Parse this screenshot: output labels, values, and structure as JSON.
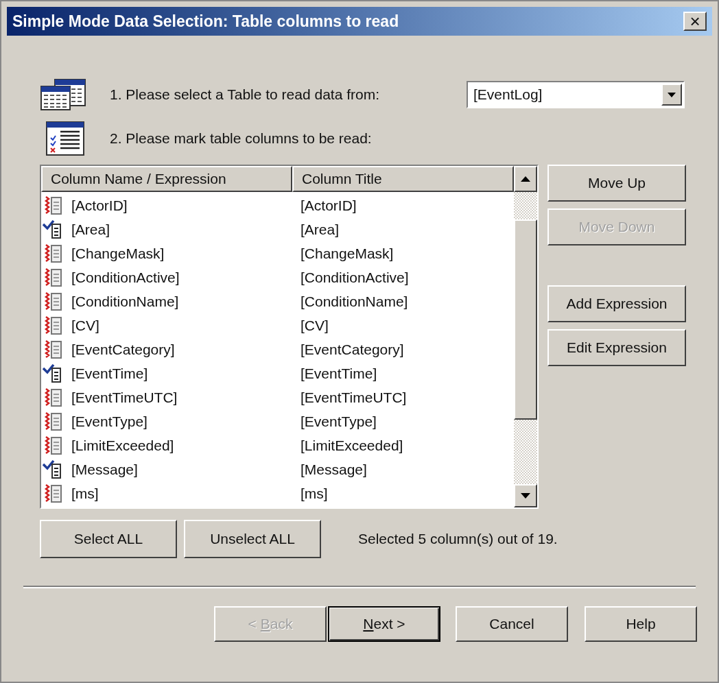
{
  "window": {
    "title": "Simple Mode Data Selection: Table columns to read",
    "close": "×"
  },
  "step1": {
    "label": "1. Please select a Table to read data from:",
    "table_select": {
      "value": "[EventLog]"
    }
  },
  "step2": {
    "label": "2. Please mark table columns to be read:"
  },
  "table": {
    "columns": [
      "Column Name / Expression",
      "Column Title"
    ],
    "rows": [
      {
        "name": "[ActorID]",
        "title": "[ActorID]",
        "checked": false
      },
      {
        "name": "[Area]",
        "title": "[Area]",
        "checked": true
      },
      {
        "name": "[ChangeMask]",
        "title": "[ChangeMask]",
        "checked": false
      },
      {
        "name": "[ConditionActive]",
        "title": "[ConditionActive]",
        "checked": false
      },
      {
        "name": "[ConditionName]",
        "title": "[ConditionName]",
        "checked": false
      },
      {
        "name": "[CV]",
        "title": "[CV]",
        "checked": false
      },
      {
        "name": "[EventCategory]",
        "title": "[EventCategory]",
        "checked": false
      },
      {
        "name": "[EventTime]",
        "title": "[EventTime]",
        "checked": true
      },
      {
        "name": "[EventTimeUTC]",
        "title": "[EventTimeUTC]",
        "checked": false
      },
      {
        "name": "[EventType]",
        "title": "[EventType]",
        "checked": false
      },
      {
        "name": "[LimitExceeded]",
        "title": "[LimitExceeded]",
        "checked": false
      },
      {
        "name": "[Message]",
        "title": "[Message]",
        "checked": true
      },
      {
        "name": "[ms]",
        "title": "[ms]",
        "checked": false
      }
    ]
  },
  "side_buttons": [
    {
      "label": "Move Up",
      "disabled": false
    },
    {
      "label": "Move Down",
      "disabled": true
    },
    {
      "label": "Add Expression",
      "disabled": false
    },
    {
      "label": "Edit Expression",
      "disabled": false
    }
  ],
  "select_buttons": [
    "Select ALL",
    "Unselect ALL"
  ],
  "selection_status": "Selected 5 column(s) out of 19.",
  "footer_buttons": [
    {
      "label_before": "< ",
      "access_key": "B",
      "label_after": "ack",
      "disabled": true,
      "default": false
    },
    {
      "access_key": "N",
      "label_after": "ext >",
      "disabled": false,
      "default": true
    },
    {
      "label": "Cancel",
      "disabled": false,
      "default": false
    },
    {
      "label": "Help",
      "disabled": false,
      "default": false
    }
  ]
}
